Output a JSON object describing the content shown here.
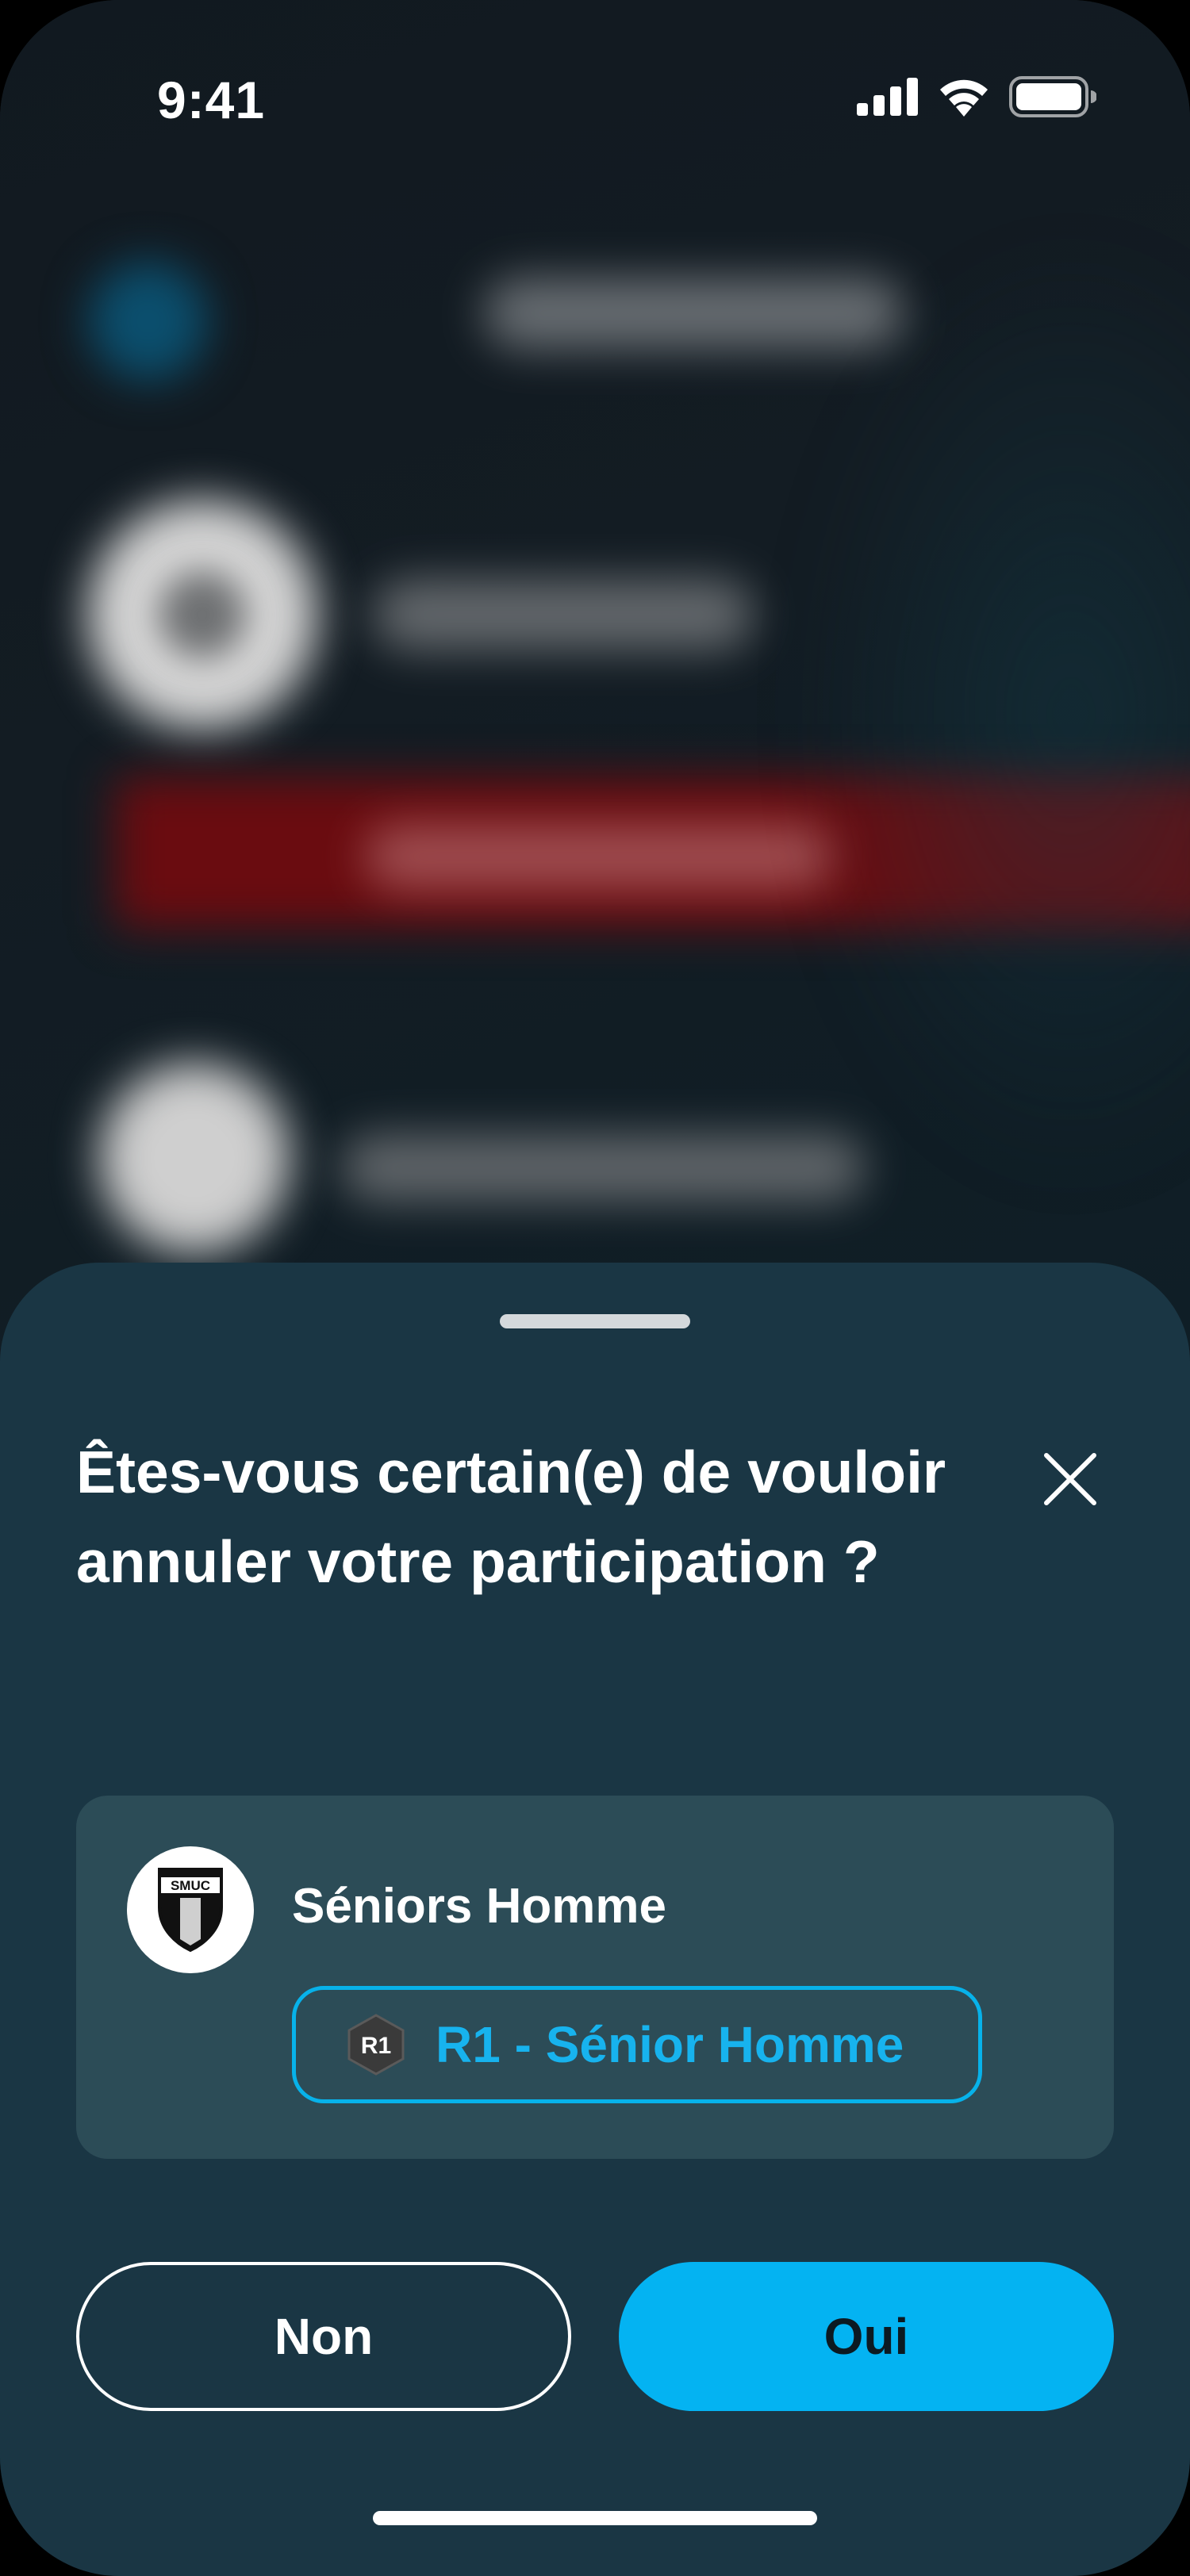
{
  "status_bar": {
    "time": "9:41",
    "icons": [
      "cellular-signal-icon",
      "wifi-icon",
      "battery-icon"
    ]
  },
  "sheet": {
    "title": "Êtes-vous certain(e) de vouloir annuler votre participation ?",
    "team": {
      "logo_text": "SMUC",
      "name": "Séniors Homme",
      "category_badge": "R1",
      "category_label": "R1 - Sénior Homme"
    },
    "buttons": {
      "no_label": "Non",
      "yes_label": "Oui"
    }
  },
  "colors": {
    "sheet_background": "#1a3644",
    "card_background": "#2c4c57",
    "accent": "#04b3f2",
    "chip_text": "#17b3ee"
  }
}
